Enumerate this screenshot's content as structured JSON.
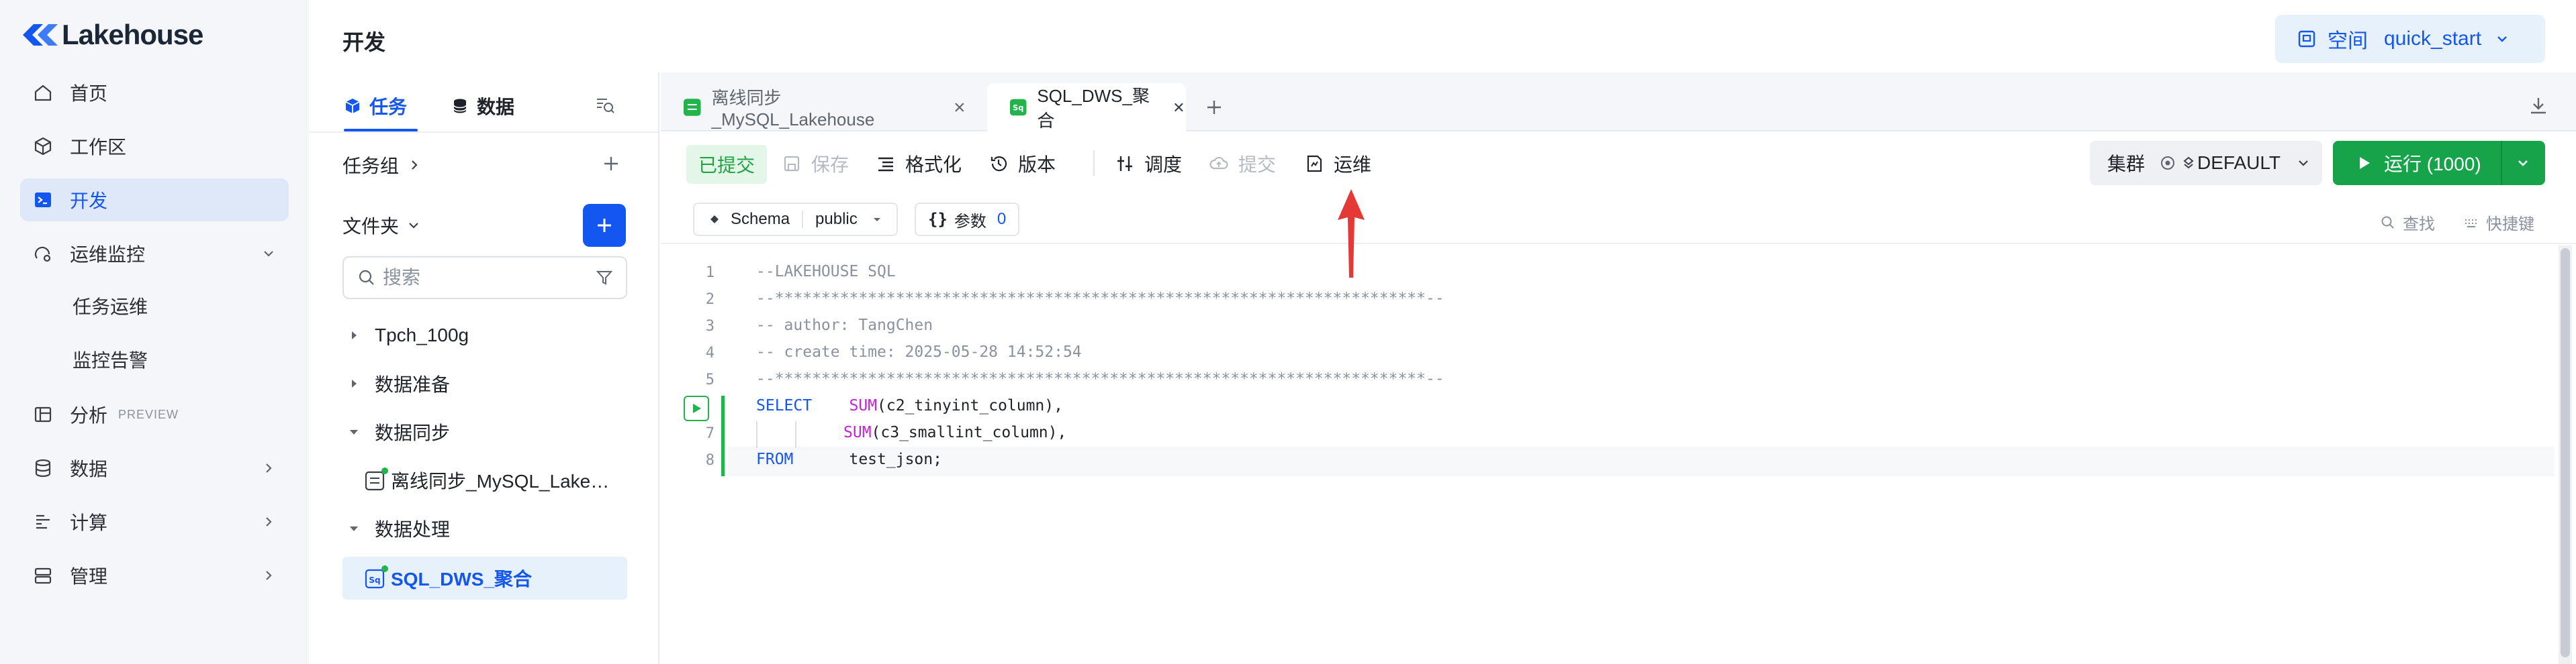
{
  "app": {
    "logo_text": "Lakehouse",
    "page_title": "开发"
  },
  "nav": {
    "items": [
      {
        "label": "首页",
        "icon": "home-icon"
      },
      {
        "label": "工作区",
        "icon": "cube-icon"
      },
      {
        "label": "开发",
        "icon": "terminal-icon",
        "active": true
      },
      {
        "label": "运维监控",
        "icon": "monitor-icon",
        "expanded": true
      },
      {
        "label": "分析",
        "icon": "analysis-icon",
        "tag": "PREVIEW"
      },
      {
        "label": "数据",
        "icon": "database-icon"
      },
      {
        "label": "计算",
        "icon": "compute-icon"
      },
      {
        "label": "管理",
        "icon": "manage-icon"
      }
    ],
    "sub_items": [
      "任务运维",
      "监控告警"
    ]
  },
  "space": {
    "label": "空间",
    "value": "quick_start"
  },
  "panel": {
    "tab_task": "任务",
    "tab_data": "数据",
    "task_group": "任务组",
    "folder": "文件夹",
    "search_placeholder": "搜索",
    "tree": [
      {
        "label": "Tpch_100g",
        "type": "folder",
        "expanded": false
      },
      {
        "label": "数据准备",
        "type": "folder",
        "expanded": false
      },
      {
        "label": "数据同步",
        "type": "folder",
        "expanded": true
      },
      {
        "label": "离线同步_MySQL_Lake…",
        "type": "sync-task"
      },
      {
        "label": "数据处理",
        "type": "folder",
        "expanded": true
      },
      {
        "label": "SQL_DWS_聚合",
        "type": "sql-task",
        "selected": true
      }
    ]
  },
  "editor_tabs": [
    {
      "label": "离线同步_MySQL_Lakehouse",
      "active": false
    },
    {
      "label": "SQL_DWS_聚合",
      "active": true
    }
  ],
  "toolbar": {
    "submitted": "已提交",
    "save": "保存",
    "format": "格式化",
    "version": "版本",
    "schedule": "调度",
    "submit": "提交",
    "ops": "运维",
    "cluster_label": "集群",
    "cluster_value": "DEFAULT",
    "run": "运行 (1000)"
  },
  "schema_bar": {
    "schema_label": "Schema",
    "schema_value": "public",
    "params_label": "参数",
    "params_count": "0",
    "find": "查找",
    "shortcuts": "快捷键"
  },
  "code": {
    "lines": [
      {
        "n": "1",
        "text": "--LAKEHOUSE SQL"
      },
      {
        "n": "2",
        "text": "--**********************************************************************--"
      },
      {
        "n": "3",
        "text": "-- author: TangChen"
      },
      {
        "n": "4",
        "text": "-- create time: 2025-05-28 14:52:54"
      },
      {
        "n": "5",
        "text": "--**********************************************************************--"
      },
      {
        "n": "6",
        "kw": "SELECT",
        "fn": "SUM",
        "rest": "(c2_tinyint_column),"
      },
      {
        "n": "7",
        "fn": "SUM",
        "rest": "(c3_smallint_column),"
      },
      {
        "n": "8",
        "kw": "FROM",
        "rest": "test_json;"
      }
    ]
  },
  "colors": {
    "accent": "#1456f0",
    "success": "#16a34a",
    "annotation": "#e53935"
  }
}
